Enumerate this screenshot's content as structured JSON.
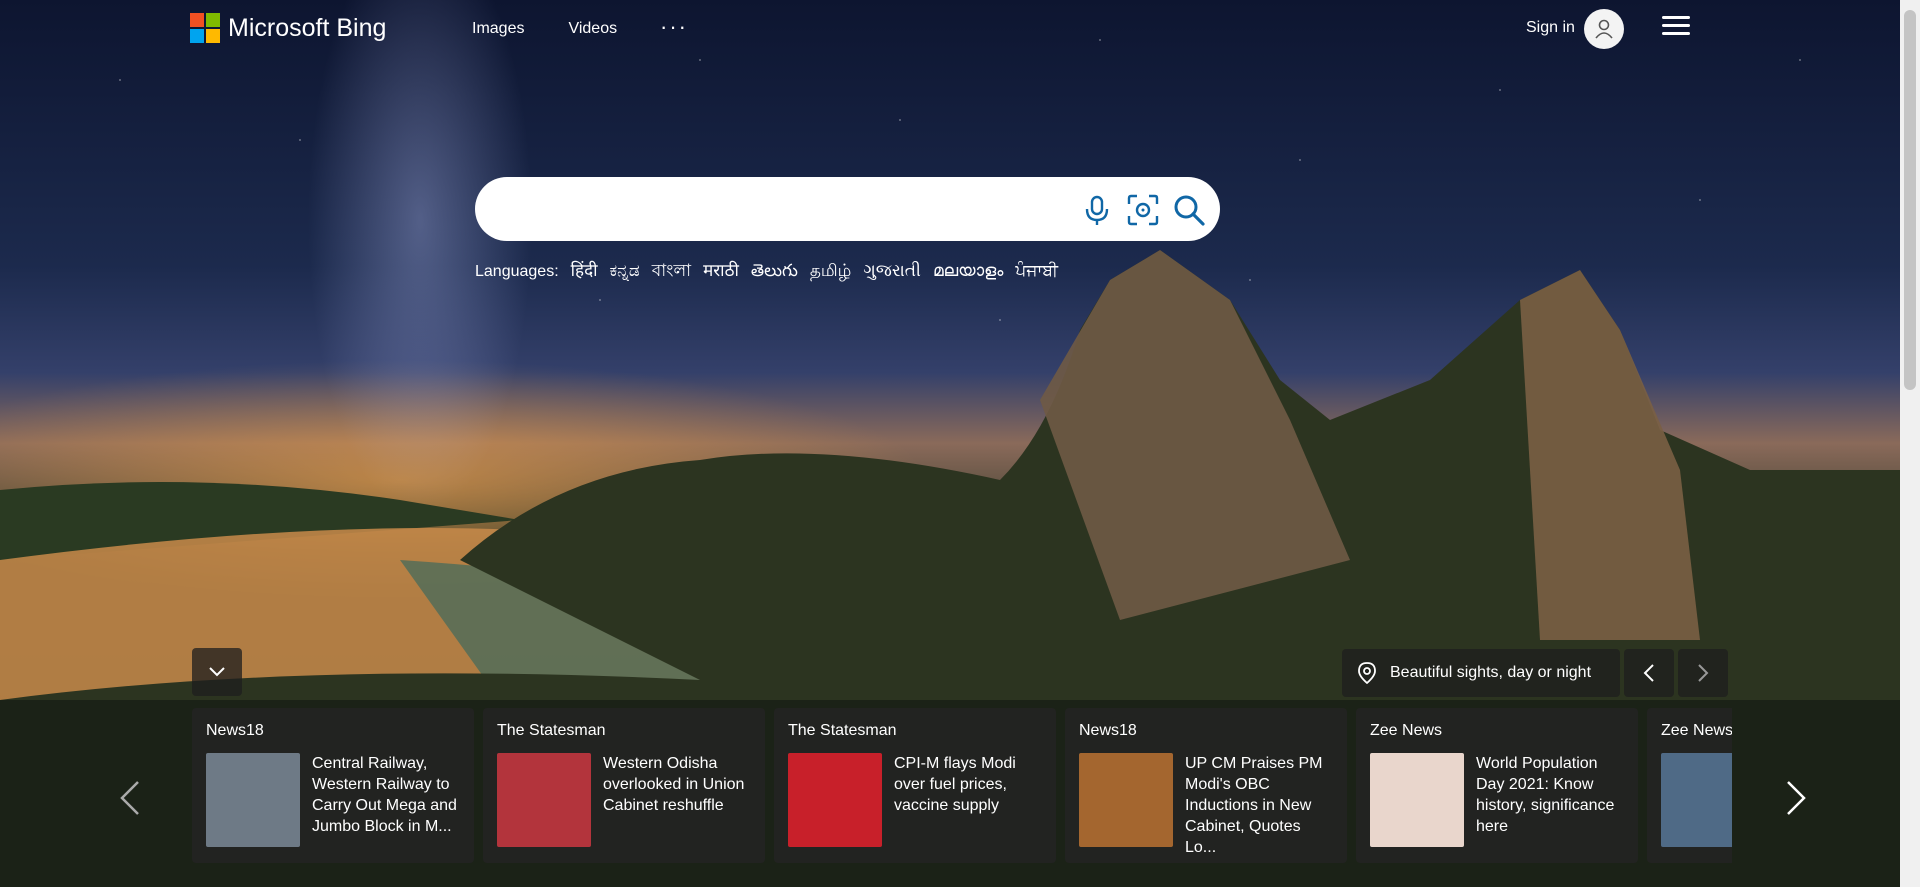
{
  "brand": {
    "name": "Microsoft Bing",
    "logo_colors": [
      "#f25022",
      "#7fba00",
      "#00a4ef",
      "#ffb900"
    ]
  },
  "nav": {
    "images": "Images",
    "videos": "Videos",
    "more": "···"
  },
  "account": {
    "signin": "Sign in"
  },
  "search": {
    "placeholder": ""
  },
  "languages": {
    "label": "Languages:",
    "items": [
      "हिंदी",
      "ಕನ್ನಡ",
      "বাংলা",
      "मराठी",
      "తెలుగు",
      "தமிழ்",
      "ગુજરાતી",
      "മലയാളം",
      "ਪੰਜਾਬੀ"
    ]
  },
  "image_caption": "Beautiful sights, day or night",
  "news": [
    {
      "source": "News18",
      "headline": "Central Railway, Western Railway to Carry Out Mega and Jumbo Block in M...",
      "thumb_color": "#6e7a86"
    },
    {
      "source": "The Statesman",
      "headline": "Western Odisha overlooked in Union Cabinet reshuffle",
      "thumb_color": "#b3343c"
    },
    {
      "source": "The Statesman",
      "headline": "CPI-M flays Modi over fuel prices, vaccine supply",
      "thumb_color": "#c8202a"
    },
    {
      "source": "News18",
      "headline": "UP CM Praises PM Modi's OBC Inductions in New Cabinet, Quotes Lo...",
      "thumb_color": "#a4662f"
    },
    {
      "source": "Zee News",
      "headline": "World Population Day 2021: Know history, significance here",
      "thumb_color": "#e9d6cc"
    },
    {
      "source": "Zee News",
      "headline": "",
      "thumb_color": "#4f6a86"
    }
  ]
}
